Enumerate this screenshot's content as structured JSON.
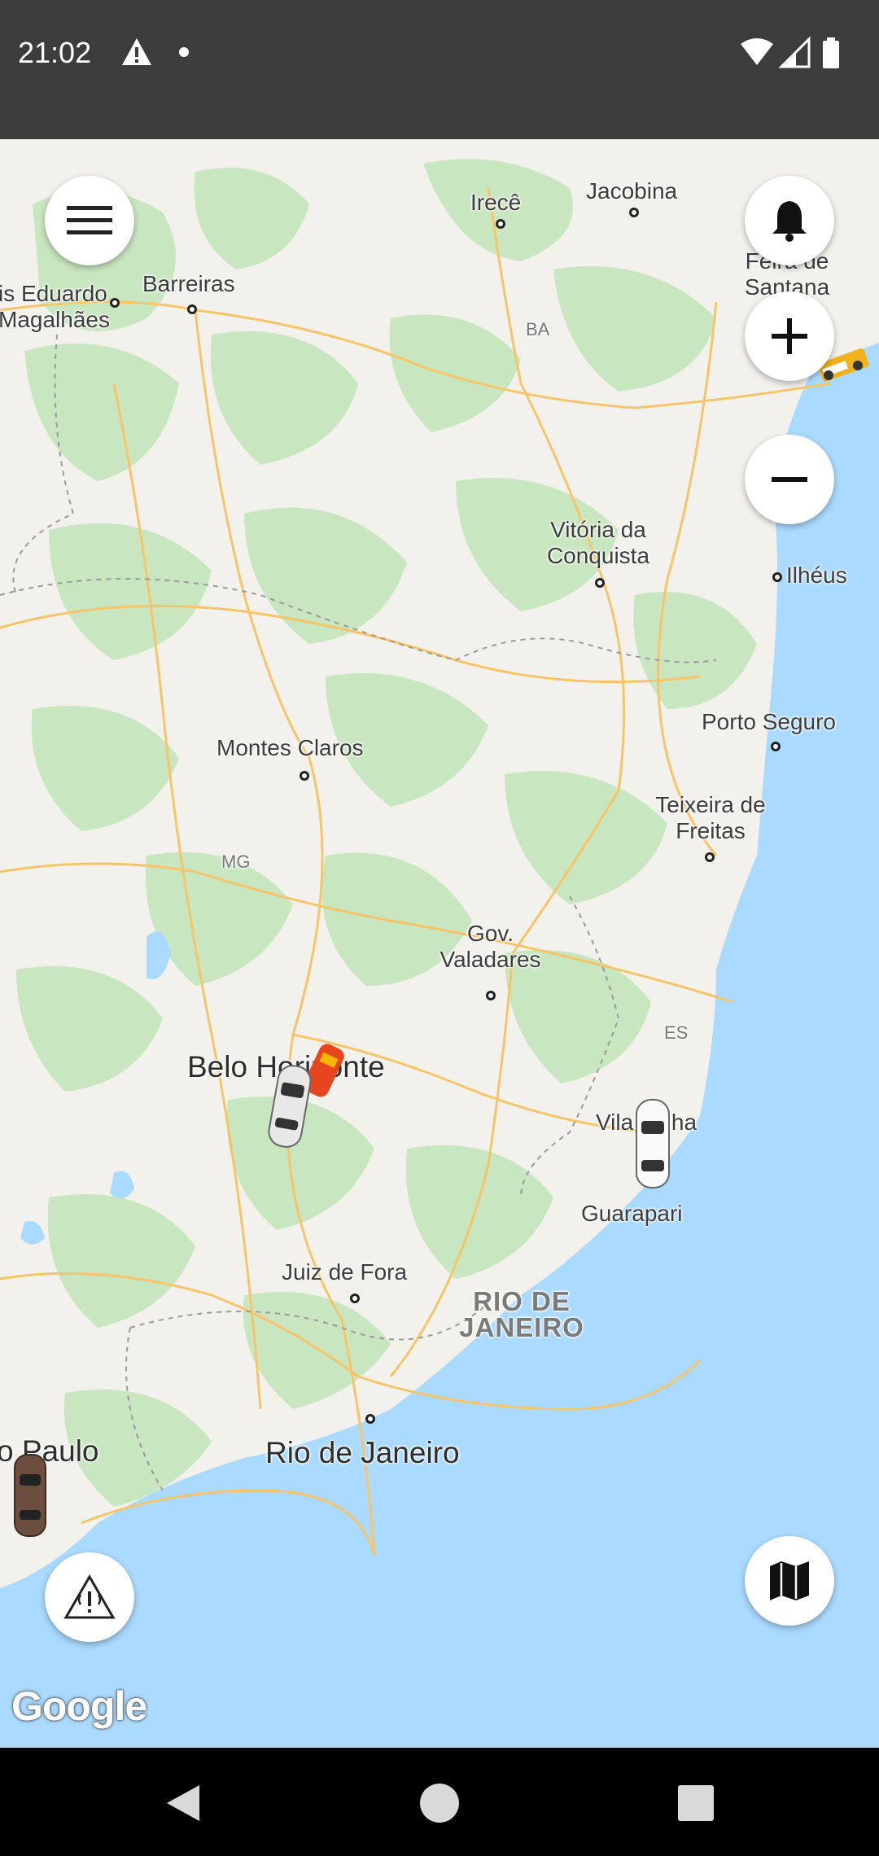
{
  "status_bar": {
    "time": "21:02",
    "icons": [
      "warning-icon",
      "notification-dot-icon",
      "wifi-icon",
      "cellular-signal-icon",
      "battery-icon"
    ]
  },
  "map": {
    "cities": [
      {
        "name": "Irecê"
      },
      {
        "name": "Jacobina"
      },
      {
        "name": "Feira de Santana"
      },
      {
        "name": "is Eduardo Magalhães"
      },
      {
        "name": "Barreiras"
      },
      {
        "name": "BA"
      },
      {
        "name": "Vitória da Conquista"
      },
      {
        "name": "Ilhéus"
      },
      {
        "name": "Porto Seguro"
      },
      {
        "name": "Montes Claros"
      },
      {
        "name": "Teixeira de Freitas"
      },
      {
        "name": "MG"
      },
      {
        "name": "Gov. Valadares"
      },
      {
        "name": "ES"
      },
      {
        "name": "Belo Horizonte"
      },
      {
        "name": "Vila Velha"
      },
      {
        "name": "Guarapari"
      },
      {
        "name": "Juiz de Fora"
      },
      {
        "name": "RIO DE JANEIRO"
      },
      {
        "name": "o Paulo"
      },
      {
        "name": "Rio de Janeiro"
      }
    ],
    "attribution": "Google",
    "colors": {
      "land": "#f3f1ec",
      "forest": "#c8e6c0",
      "water": "#aadaff",
      "roads": "#f6c56a"
    }
  },
  "buttons": {
    "menu": "menu-icon",
    "notifications": "bell-icon",
    "zoom_in": "plus-icon",
    "zoom_out": "minus-icon",
    "alert": "warning-broadcast-icon",
    "map_type": "map-icon"
  },
  "nav_bar": {
    "back": "back-icon",
    "home": "home-icon",
    "recents": "recents-icon"
  }
}
